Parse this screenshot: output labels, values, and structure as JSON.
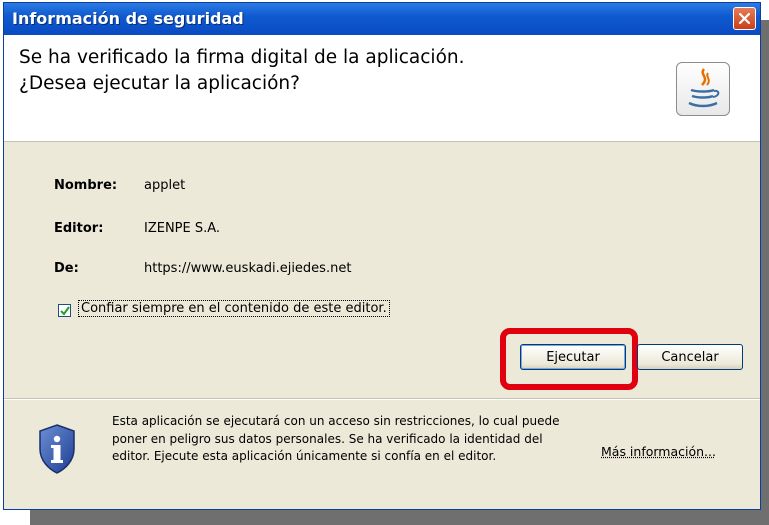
{
  "dialog": {
    "title": "Información de seguridad",
    "message_line1": "Se ha verificado la firma digital de la aplicación.",
    "message_line2": "¿Desea ejecutar la aplicación?"
  },
  "details": {
    "name_label": "Nombre:",
    "name_value": "applet",
    "publisher_label": "Editor:",
    "publisher_value": "IZENPE S.A.",
    "from_label": "De:",
    "from_value": "https://www.euskadi.ejiedes.net"
  },
  "trust_checkbox": {
    "label": "Confiar siempre en el contenido de este editor.",
    "checked": true
  },
  "buttons": {
    "run": "Ejecutar",
    "cancel": "Cancelar"
  },
  "footer": {
    "warning": "Esta aplicación se ejecutará con un acceso sin restricciones, lo cual puede poner en peligro sus datos personales. Se ha verificado la identidad del editor. Ejecute esta aplicación únicamente si confía en el editor.",
    "more_info": "Más información..."
  },
  "icons": {
    "close": "close-icon",
    "app_logo": "java-logo-icon",
    "info": "info-shield-icon",
    "check": "checkmark-icon"
  },
  "colors": {
    "titlebar": "#0a4bc2",
    "highlight": "#e0000f",
    "dialog_bg": "#ece9d8"
  }
}
